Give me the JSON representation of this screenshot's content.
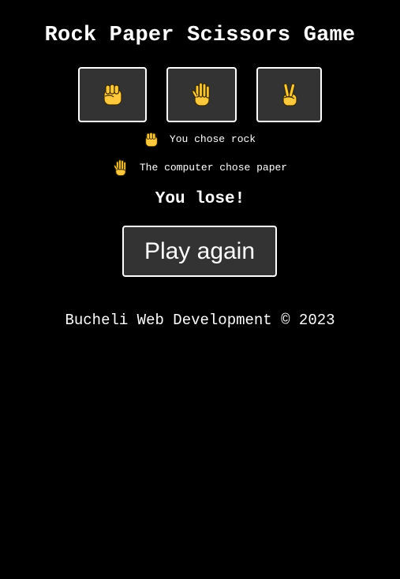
{
  "title": "Rock Paper Scissors Game",
  "choices": [
    {
      "name": "rock",
      "icon": "raised-fist-icon"
    },
    {
      "name": "paper",
      "icon": "raised-hand-icon"
    },
    {
      "name": "scissors",
      "icon": "victory-hand-icon"
    }
  ],
  "result": {
    "user_icon": "raised-fist-icon",
    "user_text": "You chose rock",
    "computer_icon": "raised-hand-icon",
    "computer_text": "The computer chose paper",
    "outcome": "You lose!"
  },
  "play_again_label": "Play again",
  "footer": "Bucheli Web Development © 2023",
  "colors": {
    "background": "#000000",
    "button_bg": "#333333",
    "button_border": "#ffffff",
    "text": "#ffffff",
    "emoji_yellow": "#FFC83D"
  }
}
